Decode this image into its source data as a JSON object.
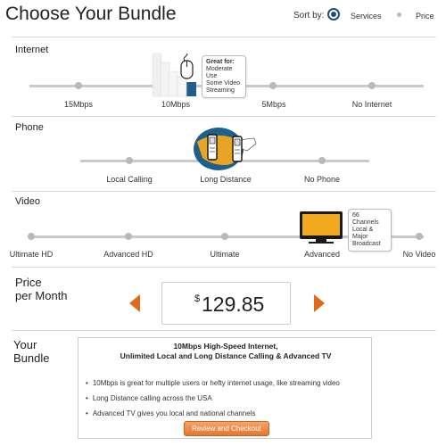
{
  "header": {
    "title": "Choose Your Bundle",
    "sort_label": "Sort by:",
    "sort_options": [
      "Services",
      "Price"
    ],
    "sort_selected": "Services"
  },
  "internet": {
    "label": "Internet",
    "options": [
      "15Mbps",
      "10Mbps",
      "5Mbps",
      "No Internet"
    ],
    "selected": "10Mbps",
    "tooltip": {
      "title": "Great for:",
      "lines": [
        "Moderate Use",
        "Some Video",
        "Streaming"
      ]
    }
  },
  "phone": {
    "label": "Phone",
    "options": [
      "Local Calling",
      "Long Distance",
      "No Phone"
    ],
    "selected": "Long Distance"
  },
  "video": {
    "label": "Video",
    "options": [
      "Ultimate HD",
      "Advanced HD",
      "Ultimate",
      "Advanced",
      "No Video"
    ],
    "selected": "Advanced",
    "tooltip": {
      "lines": [
        "66 Channels",
        "Local & Major",
        "Broadcast"
      ]
    }
  },
  "price": {
    "label_line1": "Price",
    "label_line2": "per Month",
    "currency": "$",
    "value": "129.85"
  },
  "bundle": {
    "label_line1": "Your",
    "label_line2": "Bundle",
    "headline_line1": "10Mbps High-Speed Internet,",
    "headline_line2": "Unlimited Local and Long Distance Calling & Advanced TV",
    "bullets": [
      "10Mbps is great for multiple users or hefty internet usage, like streaming video",
      "Long Distance calling across the USA",
      "Advanced TV gives you local and national channels"
    ],
    "cta_label": "Review and Checkout"
  },
  "colors": {
    "accent": "#e06a1c",
    "radio": "#1f4f7a",
    "tv_screen": "#f3a91e",
    "tv_body": "#1a1a1a",
    "globe": "#1f5f8b"
  }
}
